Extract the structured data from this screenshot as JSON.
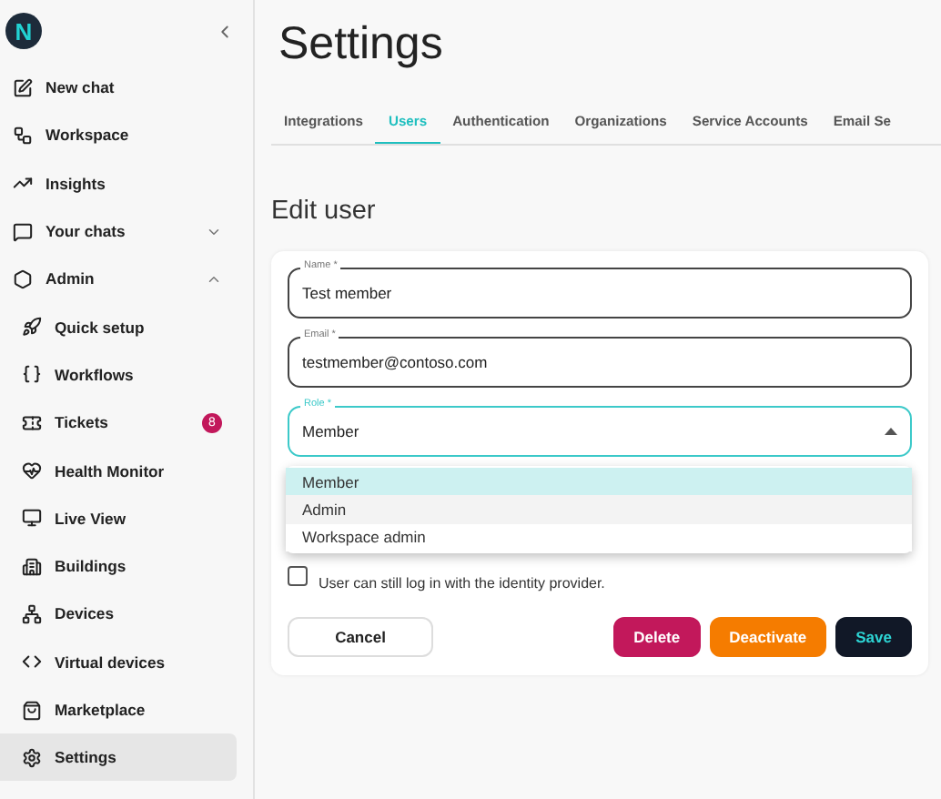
{
  "logo": "N",
  "sidebar": {
    "items": [
      {
        "label": "New chat",
        "selected": false
      },
      {
        "label": "Workspace",
        "selected": false
      },
      {
        "label": "Insights",
        "selected": false
      },
      {
        "label": "Your chats",
        "selected": false,
        "expanded": false
      },
      {
        "label": "Admin",
        "selected": false,
        "expanded": true,
        "children": [
          {
            "label": "Quick setup",
            "selected": false
          },
          {
            "label": "Workflows",
            "selected": false
          },
          {
            "label": "Tickets",
            "selected": false,
            "badge": "8"
          },
          {
            "label": "Health Monitor",
            "selected": false
          },
          {
            "label": "Live View",
            "selected": false
          },
          {
            "label": "Buildings",
            "selected": false
          },
          {
            "label": "Devices",
            "selected": false
          },
          {
            "label": "Virtual devices",
            "selected": false
          },
          {
            "label": "Marketplace",
            "selected": false
          },
          {
            "label": "Settings",
            "selected": true
          }
        ]
      }
    ]
  },
  "title": "Settings",
  "tabs": [
    {
      "label": "Integrations",
      "selected": false
    },
    {
      "label": "Users",
      "selected": true
    },
    {
      "label": "Authentication",
      "selected": false
    },
    {
      "label": "Organizations",
      "selected": false
    },
    {
      "label": "Service Accounts",
      "selected": false
    },
    {
      "label": "Email Se",
      "selected": false
    }
  ],
  "section_title": "Edit user",
  "form": {
    "fields": [
      {
        "label": "Name *",
        "value": "Test member",
        "focused": false
      },
      {
        "label": "Email *",
        "value": "testmember@contoso.com",
        "focused": false
      },
      {
        "label": "Role *",
        "value": "Member",
        "focused": true,
        "kind": "select"
      }
    ],
    "role_options": [
      {
        "label": "Member",
        "selected": true,
        "hovered": false
      },
      {
        "label": "Admin",
        "selected": false,
        "hovered": true
      },
      {
        "label": "Workspace admin",
        "selected": false,
        "hovered": false
      }
    ],
    "checkbox": {
      "checked": false,
      "description": "User can still log in with the identity provider."
    },
    "buttons": [
      {
        "label": "Cancel",
        "kind": "outline"
      },
      {
        "label": "Delete",
        "kind": "danger"
      },
      {
        "label": "Deactivate",
        "kind": "warning"
      },
      {
        "label": "Save",
        "kind": "primary"
      }
    ]
  }
}
